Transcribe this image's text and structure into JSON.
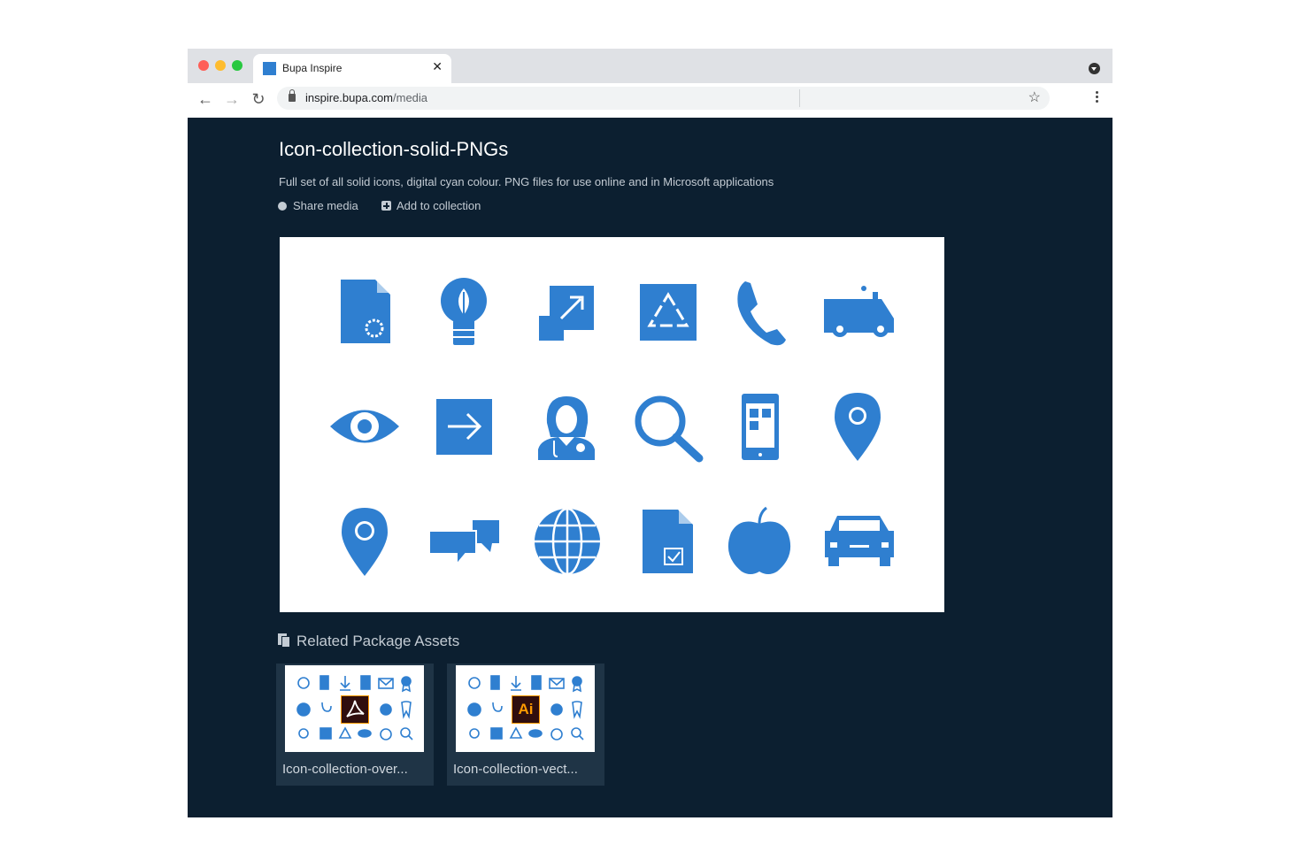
{
  "browser": {
    "tab_title": "Bupa Inspire",
    "tab_close": "✕",
    "url_host": "inspire.bupa.com",
    "url_path": "/media",
    "back": "←",
    "forward": "→",
    "reload": "↻",
    "bookmark": "☆"
  },
  "colors": {
    "page_background": "#0c1f30",
    "icon_blue": "#2f7fd0",
    "pdf_badge": "#ff9a00"
  },
  "media": {
    "title": "Icon-collection-solid-PNGs",
    "description": "Full set of all solid icons, digital cyan colour. PNG files for use online and in Microsoft applications",
    "share_label": "Share media",
    "add_label": "Add to collection",
    "preview_icons": [
      [
        "document-gear-icon",
        "lightbulb-leaf-icon",
        "expand-arrow-icon",
        "recycle-icon",
        "phone-icon",
        "ambulance-icon"
      ],
      [
        "eye-icon",
        "arrow-right-box-icon",
        "doctor-icon",
        "magnifier-icon",
        "mobile-app-icon",
        "map-pin-icon"
      ],
      [
        "map-pin-icon",
        "chat-bubbles-icon",
        "globe-icon",
        "document-check-icon",
        "apple-icon",
        "car-icon"
      ]
    ]
  },
  "related": {
    "heading": "Related Package Assets",
    "assets": [
      {
        "label": "Icon-collection-over...",
        "badge": "",
        "badge_icon": "acrobat-pdf-icon"
      },
      {
        "label": "Icon-collection-vect...",
        "badge": "Ai",
        "badge_icon": "illustrator-icon"
      }
    ]
  }
}
